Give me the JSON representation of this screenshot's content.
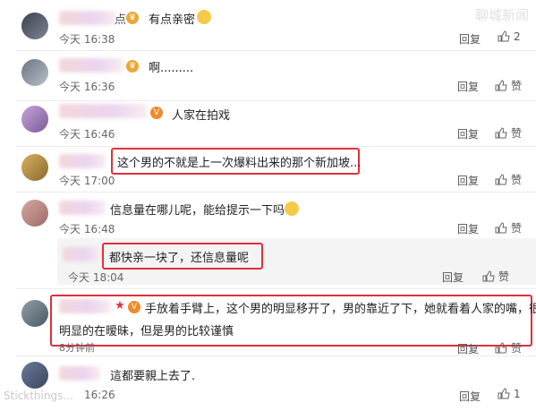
{
  "watermark_top": "聊城新闻",
  "watermark_bottom": "Stickthings...",
  "comments": [
    {
      "name_suffix": "点",
      "text": "有点亲密",
      "time": "今天 16:38",
      "reply": "回复",
      "likes": "2"
    },
    {
      "text": "啊.........",
      "time": "今天 16:36",
      "reply": "回复",
      "likes": "赞"
    },
    {
      "text": "人家在拍戏",
      "time": "今天 16:46",
      "reply": "回复",
      "likes": "赞"
    },
    {
      "text": "这个男的不就是上一次爆料出来的那个新加坡...",
      "time": "今天 17:00",
      "reply": "回复",
      "likes": "赞"
    },
    {
      "text": "信息量在哪儿呢，能给提示一下吗",
      "time": "今天 16:48",
      "reply": "回复",
      "likes": "赞"
    },
    {
      "text": "都快亲一块了，还信息量呢",
      "time": "今天 18:04",
      "reply": "回复",
      "likes": "赞"
    },
    {
      "text_line1": "手放着手臂上，这个男的明显移开了，男的靠近了下，她就看着人家的嘴，很",
      "text_line2": "明显的在暧昧，但是男的比较谨慎",
      "time": "8分钟前",
      "reply": "回复",
      "likes": "赞"
    },
    {
      "text": "這都要親上去了.",
      "time": "16:26",
      "reply": "回复",
      "likes": "1"
    }
  ],
  "colors": {
    "highlight": "#e0303a",
    "sub_bg": "#f4f4f4"
  }
}
